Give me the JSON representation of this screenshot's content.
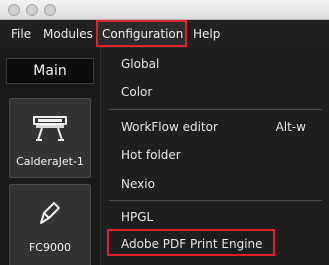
{
  "menubar": {
    "items": [
      "File",
      "Modules",
      "Configuration",
      "Help"
    ]
  },
  "left_panel": {
    "main_tab": "Main",
    "devices": [
      {
        "label": "CalderaJet-1",
        "icon": "printer-icon"
      },
      {
        "label": "FC9000",
        "icon": "cutter-blade-icon"
      }
    ]
  },
  "dropdown": {
    "groups": [
      [
        {
          "label": "Global"
        },
        {
          "label": "Color"
        }
      ],
      [
        {
          "label": "WorkFlow editor",
          "shortcut": "Alt-w"
        },
        {
          "label": "Hot folder"
        },
        {
          "label": "Nexio"
        }
      ],
      [
        {
          "label": "HPGL"
        },
        {
          "label": "Adobe PDF Print Engine"
        }
      ]
    ]
  },
  "highlight_color": "#e0202a"
}
